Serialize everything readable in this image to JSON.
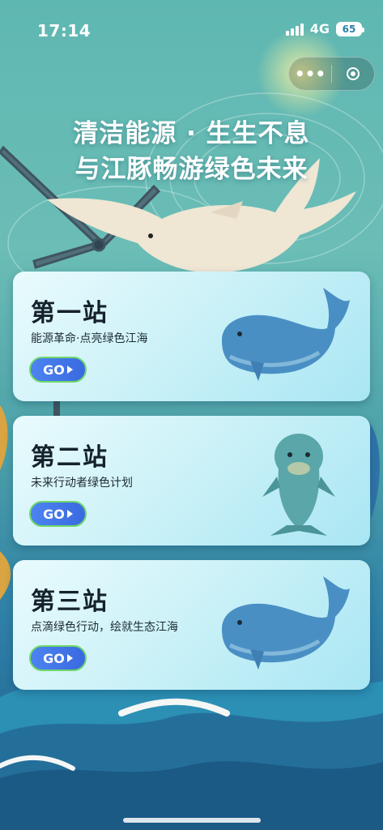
{
  "status_bar": {
    "time": "17:14",
    "network": "4G",
    "battery": "65"
  },
  "capsule": {
    "more_icon": "more-dots-icon",
    "close_icon": "target-circle-icon"
  },
  "headline": {
    "line1": "清洁能源 · 生生不息",
    "line2": "与江豚畅游绿色未来"
  },
  "stations": [
    {
      "title": "第一站",
      "subtitle": "能源革命·点亮绿色江海",
      "button": "GO",
      "icon": "whale-icon"
    },
    {
      "title": "第二站",
      "subtitle": "未来行动者绿色计划",
      "button": "GO",
      "icon": "dolphin-icon"
    },
    {
      "title": "第三站",
      "subtitle": "点滴绿色行动，绘就生态江海",
      "button": "GO",
      "icon": "whale-icon"
    }
  ],
  "colors": {
    "accent": "#3a69e0",
    "go_border": "#6fd86a",
    "card_bg": "#cdf2f8"
  }
}
